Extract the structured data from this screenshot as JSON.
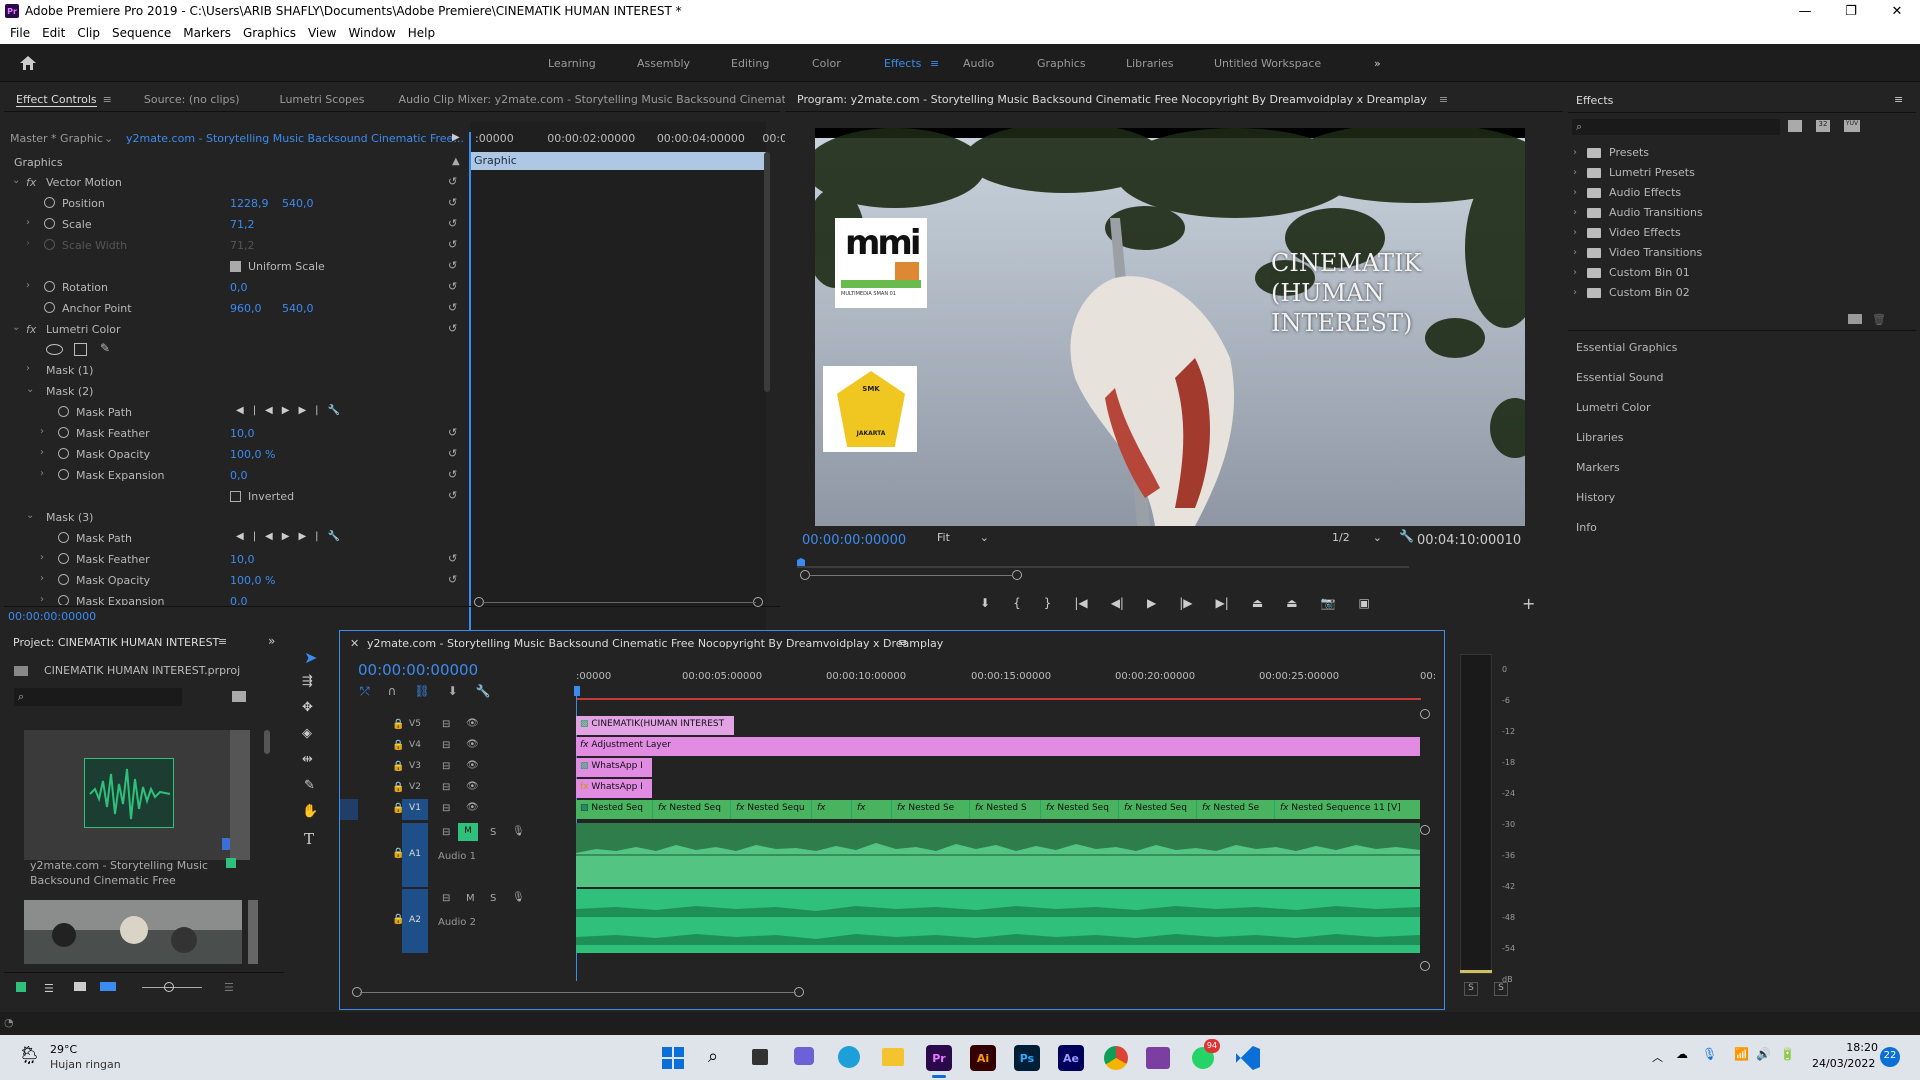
{
  "window": {
    "title": "Adobe Premiere Pro 2019 - C:\\Users\\ARIB SHAFLY\\Documents\\Adobe Premiere\\CINEMATIK HUMAN INTEREST *",
    "app_badge": "Pr"
  },
  "menu": [
    "File",
    "Edit",
    "Clip",
    "Sequence",
    "Markers",
    "Graphics",
    "View",
    "Window",
    "Help"
  ],
  "workspaces": [
    "Learning",
    "Assembly",
    "Editing",
    "Color",
    "Effects",
    "Audio",
    "Graphics",
    "Libraries",
    "Untitled Workspace"
  ],
  "workspace_active": "Effects",
  "source_tabs": [
    "Effect Controls",
    "Source: (no clips)",
    "Lumetri Scopes",
    "Audio Clip Mixer: y2mate.com - Storytelling  Music Backsound Cinematic F"
  ],
  "effect_controls": {
    "master": "Master * Graphic",
    "clip": "y2mate.com - Storytelling  Music Backsound Cinematic Free...",
    "ruler": [
      ":00000",
      "00:00:02:00000",
      "00:00:04:00000",
      "00:0"
    ],
    "graphic_bar": "Graphic",
    "section": "Graphics",
    "rows": [
      {
        "label": "Vector Motion",
        "kind": "fx"
      },
      {
        "label": "Position",
        "v1": "1228,9",
        "v2": "540,0"
      },
      {
        "label": "Scale",
        "v1": "71,2"
      },
      {
        "label": "Scale Width",
        "v1": "71,2",
        "dim": true
      },
      {
        "label": "Uniform Scale",
        "kind": "check"
      },
      {
        "label": "Rotation",
        "v1": "0,0"
      },
      {
        "label": "Anchor Point",
        "v1": "960,0",
        "v2": "540,0"
      },
      {
        "label": "Lumetri Color",
        "kind": "fx"
      },
      {
        "label": "Mask (1)"
      },
      {
        "label": "Mask (2)"
      },
      {
        "label": "Mask Path"
      },
      {
        "label": "Mask Feather",
        "v1": "10,0"
      },
      {
        "label": "Mask Opacity",
        "v1": "100,0 %"
      },
      {
        "label": "Mask Expansion",
        "v1": "0,0"
      },
      {
        "label": "Inverted",
        "kind": "check"
      },
      {
        "label": "Mask (3)"
      },
      {
        "label": "Mask Path"
      },
      {
        "label": "Mask Feather",
        "v1": "10,0"
      },
      {
        "label": "Mask Opacity",
        "v1": "100,0 %"
      },
      {
        "label": "Mask Expansion",
        "v1": "0,0"
      }
    ],
    "timecode": "00:00:00:00000"
  },
  "program": {
    "title": "Program: y2mate.com - Storytelling  Music Backsound Cinematic Free Nocopyright By Dreamvoidplay x Dreamplay",
    "overlay_title_line1": "CINEMATIK",
    "overlay_title_line2": "(HUMAN INTEREST)",
    "logo1_text": "MULTIMEDIA SMAN 01",
    "logo2_top": "SMK",
    "logo2_bottom": "JAKARTA",
    "timecode": "00:00:00:00000",
    "fit": "Fit",
    "resolution": "1/2",
    "duration": "00:04:10:00010"
  },
  "effects_panel": {
    "title": "Effects",
    "tree": [
      "Presets",
      "Lumetri Presets",
      "Audio Effects",
      "Audio Transitions",
      "Video Effects",
      "Video Transitions",
      "Custom Bin 01",
      "Custom Bin 02"
    ],
    "bin_numbers": [
      "32",
      "YUV"
    ],
    "collapsed": [
      "Essential Graphics",
      "Essential Sound",
      "Lumetri Color",
      "Libraries",
      "Markers",
      "History",
      "Info"
    ]
  },
  "project": {
    "title": "Project: CINEMATIK HUMAN INTEREST",
    "file": "CINEMATIK HUMAN INTEREST.prproj",
    "item1_line1": "y2mate.com - Storytelling  Music",
    "item1_line2": "Backsound Cinematic Free"
  },
  "timeline": {
    "title": "y2mate.com - Storytelling  Music Backsound Cinematic Free Nocopyright By Dreamvoidplay x Dreamplay",
    "timecode": "00:00:00:00000",
    "ruler": [
      ":00000",
      "00:00:05:00000",
      "00:00:10:00000",
      "00:00:15:00000",
      "00:00:20:00000",
      "00:00:25:00000",
      "00:"
    ],
    "video_tracks": [
      "V5",
      "V4",
      "V3",
      "V2",
      "V1"
    ],
    "v1_active": "V1",
    "audio_tracks": [
      {
        "id": "A1",
        "name": "Audio 1"
      },
      {
        "id": "A2",
        "name": "Audio 2"
      }
    ],
    "mute": "M",
    "solo": "S",
    "clips_v5": "CINEMATIK(HUMAN INTEREST",
    "clips_v4": "Adjustment Layer",
    "clips_v3": "WhatsApp I",
    "clips_v2": "WhatsApp I",
    "clips_v1": [
      "Nested Seq",
      "Nested Seq",
      "Nested Sequ",
      "",
      "",
      "Nested Se",
      "Nested S",
      "Nested Seq",
      "Nested Seq",
      "Nested Se",
      "Nested Sequence 11 [V]"
    ],
    "fx": "fx"
  },
  "meter": {
    "scale": [
      "0",
      "-6",
      "-12",
      "-18",
      "-24",
      "-30",
      "-36",
      "-42",
      "-48",
      "-54",
      "dB"
    ],
    "solo": "S"
  },
  "taskbar": {
    "temp": "29°C",
    "weather": "Hujan ringan",
    "time": "18:20",
    "date": "24/03/2022",
    "badge": "94",
    "notif": "22",
    "apps": [
      "Pr",
      "Ai",
      "Ps",
      "Ae"
    ]
  },
  "colors": {
    "accent": "#3c8bf0",
    "clip_pink": "#e28ee3",
    "clip_green": "#49b360",
    "audio_green": "#2fc07c"
  }
}
